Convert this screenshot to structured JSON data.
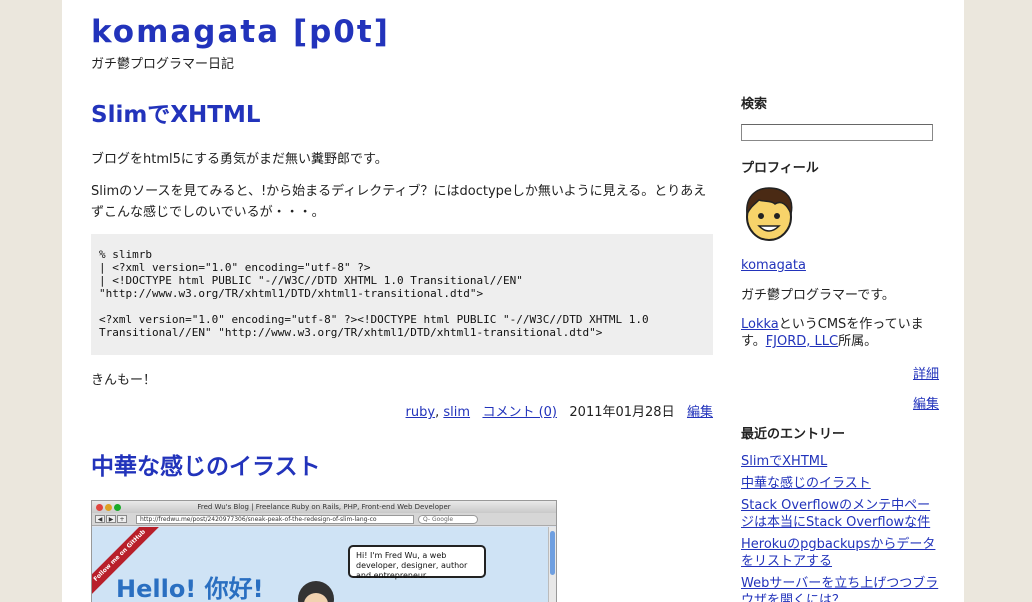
{
  "site": {
    "title": "komagata [p0t]",
    "description": "ガチ鬱プログラマー日記"
  },
  "entries": [
    {
      "title": "SlimでXHTML",
      "paragraphs": [
        "ブログをhtml5にする勇気がまだ無い糞野郎です。",
        "Slimのソースを見てみると、!から始まるディレクティブ？にはdoctypeしか無いように見える。とりあえずこんな感じでしのいでいるが・・・。"
      ],
      "code": "% slimrb\n| <?xml version=\"1.0\" encoding=\"utf-8\" ?>\n| <!DOCTYPE html PUBLIC \"-//W3C//DTD XHTML 1.0 Transitional//EN\"\n\"http://www.w3.org/TR/xhtml1/DTD/xhtml1-transitional.dtd\">\n\n<?xml version=\"1.0\" encoding=\"utf-8\" ?><!DOCTYPE html PUBLIC \"-//W3C//DTD XHTML 1.0\nTransitional//EN\" \"http://www.w3.org/TR/xhtml1/DTD/xhtml1-transitional.dtd\">",
      "closing": "きんもー！",
      "tags": [
        "ruby",
        "slim"
      ],
      "tag_separator": ",",
      "comments_label": "コメント (0)",
      "date": "2011年01月28日",
      "edit_label": "編集"
    },
    {
      "title": "中華な感じのイラスト",
      "screenshot": {
        "window_title": "Fred Wu's Blog | Freelance Ruby on Rails, PHP, Front-end Web Developer",
        "url": "http://fredwu.me/post/2420977306/sneak-peak-of-the-redesign-of-slim-lang-co",
        "search_placeholder": "Q- Google",
        "ribbon": "Follow me on GitHub",
        "hello": "Hello! 你好!",
        "bubble": "Hi! I'm Fred Wu, a web developer, designer, author and entrepreneur.",
        "nav": [
          "◀",
          "▶",
          "+"
        ]
      }
    }
  ],
  "sidebar": {
    "search_heading": "検索",
    "search_value": "",
    "profile_heading": "プロフィール",
    "profile_name": "komagata",
    "profile_bio": "ガチ鬱プログラマーです。",
    "lokka_link": "Lokka",
    "lokka_text": "というCMSを作っていま",
    "lokka_text2": "す。",
    "fjord_link": "FJORD, LLC",
    "fjord_text": "所属。",
    "details_link": "詳細",
    "edit_link": "編集",
    "recent_heading": "最近のエントリー",
    "recent": [
      "SlimでXHTML",
      "中華な感じのイラスト",
      "Stack Overflowのメンテ中ページは本当にStack Overflowな件",
      "Herokuのpgbackupsからデータをリストアする",
      "Webサーバーを立ち上げつつブラウザを開くには？"
    ]
  },
  "colors": {
    "link": "#2233bb",
    "background": "#ebe7dd",
    "code_bg": "#eeeeee"
  }
}
